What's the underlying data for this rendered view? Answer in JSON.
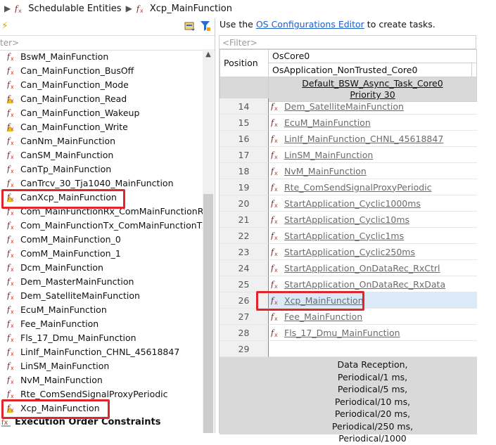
{
  "breadcrumb": {
    "root_label": "Schedulable Entities",
    "current_label": "Xcp_MainFunction"
  },
  "left_panel": {
    "filter_placeholder": "ter>",
    "items": [
      {
        "label": "BswM_MainFunction",
        "icon": "function-icon"
      },
      {
        "label": "Can_MainFunction_BusOff",
        "icon": "function-icon"
      },
      {
        "label": "Can_MainFunction_Mode",
        "icon": "function-icon"
      },
      {
        "label": "Can_MainFunction_Read",
        "icon": "function-warning-icon"
      },
      {
        "label": "Can_MainFunction_Wakeup",
        "icon": "function-icon"
      },
      {
        "label": "Can_MainFunction_Write",
        "icon": "function-warning-icon"
      },
      {
        "label": "CanNm_MainFunction",
        "icon": "function-icon"
      },
      {
        "label": "CanSM_MainFunction",
        "icon": "function-icon"
      },
      {
        "label": "CanTp_MainFunction",
        "icon": "function-icon"
      },
      {
        "label": "CanTrcv_30_Tja1040_MainFunction",
        "icon": "function-icon"
      },
      {
        "label": "CanXcp_MainFunction",
        "icon": "function-warning-icon"
      },
      {
        "label": "Com_MainFunctionRx_ComMainFunctionRx",
        "icon": "function-icon"
      },
      {
        "label": "Com_MainFunctionTx_ComMainFunctionTx",
        "icon": "function-icon"
      },
      {
        "label": "ComM_MainFunction_0",
        "icon": "function-icon"
      },
      {
        "label": "ComM_MainFunction_1",
        "icon": "function-icon"
      },
      {
        "label": "Dcm_MainFunction",
        "icon": "function-icon"
      },
      {
        "label": "Dem_MasterMainFunction",
        "icon": "function-icon"
      },
      {
        "label": "Dem_SatelliteMainFunction",
        "icon": "function-icon"
      },
      {
        "label": "EcuM_MainFunction",
        "icon": "function-icon"
      },
      {
        "label": "Fee_MainFunction",
        "icon": "function-icon"
      },
      {
        "label": "Fls_17_Dmu_MainFunction",
        "icon": "function-icon"
      },
      {
        "label": "LinIf_MainFunction_CHNL_45618847",
        "icon": "function-icon"
      },
      {
        "label": "LinSM_MainFunction",
        "icon": "function-icon"
      },
      {
        "label": "NvM_MainFunction",
        "icon": "function-icon"
      },
      {
        "label": "Rte_ComSendSignalProxyPeriodic",
        "icon": "function-icon"
      },
      {
        "label": "Xcp_MainFunction",
        "icon": "function-warning-icon"
      },
      {
        "label": "Execution Order Constraints",
        "icon": "constraints-icon"
      }
    ]
  },
  "right_panel": {
    "hint_prefix": "Use the ",
    "hint_link": "OS Configurations Editor",
    "hint_suffix": " to create tasks.",
    "filter_placeholder": "<Filter>",
    "col_position": "Position",
    "core": "OsCore0",
    "application": "OsApplication_NonTrusted_Core0",
    "task_name": "Default_BSW_Async_Task_Core0",
    "task_priority": "Priority 30",
    "rows": [
      {
        "pos": "14",
        "label": "Dem_SatelliteMainFunction"
      },
      {
        "pos": "15",
        "label": "EcuM_MainFunction"
      },
      {
        "pos": "16",
        "label": "LinIf_MainFunction_CHNL_45618847"
      },
      {
        "pos": "17",
        "label": "LinSM_MainFunction"
      },
      {
        "pos": "18",
        "label": "NvM_MainFunction"
      },
      {
        "pos": "19",
        "label": "Rte_ComSendSignalProxyPeriodic"
      },
      {
        "pos": "20",
        "label": "StartApplication_Cyclic1000ms"
      },
      {
        "pos": "21",
        "label": "StartApplication_Cyclic10ms"
      },
      {
        "pos": "22",
        "label": "StartApplication_Cyclic1ms"
      },
      {
        "pos": "23",
        "label": "StartApplication_Cyclic250ms"
      },
      {
        "pos": "24",
        "label": "StartApplication_OnDataRec_RxCtrl"
      },
      {
        "pos": "25",
        "label": "StartApplication_OnDataRec_RxData"
      },
      {
        "pos": "26",
        "label": "Xcp_MainFunction"
      },
      {
        "pos": "27",
        "label": "Fee_MainFunction"
      },
      {
        "pos": "28",
        "label": "Fls_17_Dmu_MainFunction"
      },
      {
        "pos": "29",
        "label": ""
      }
    ],
    "events": [
      "Data Reception,",
      "Periodical/1 ms,",
      "Periodical/5 ms,",
      "Periodical/10 ms,",
      "Periodical/20 ms,",
      "Periodical/250 ms,",
      "Periodical/1000"
    ]
  },
  "colors": {
    "highlight": "#e0252b",
    "link": "#1e5fc6",
    "selected_row": "#dbe9f9"
  }
}
